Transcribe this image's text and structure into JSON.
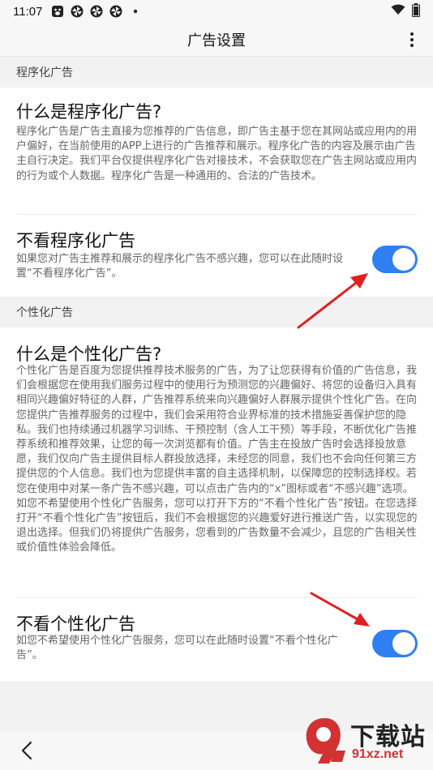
{
  "status_bar": {
    "time": "11:07",
    "icons": [
      "paw-icon",
      "pinwheel-icon",
      "pinwheel-icon",
      "pinwheel-icon",
      "dot-icon",
      "wifi-icon",
      "battery-icon"
    ]
  },
  "app_bar": {
    "title": "广告设置",
    "more_icon": "more-vertical-icon"
  },
  "programmatic": {
    "section_label": "程序化广告",
    "what_title": "什么是程序化广告?",
    "what_body": "程序化广告是广告主直接为您推荐的广告信息，即广告主基于您在其网站或应用内的用户偏好，在当前使用的APP上进行的广告推荐和展示。程序化广告的内容及展示由广告主自行决定。我们平台仅提供程序化广告对接技术，不会获取您在广告主网站或应用内的行为或个人数据。程序化广告是一种通用的、合法的广告技术。",
    "toggle_title": "不看程序化广告",
    "toggle_desc": "如果您对广告主推荐和展示的程序化广告不感兴趣，您可以在此随时设置“不看程序化广告”。",
    "toggle_on": true
  },
  "personalized": {
    "section_label": "个性化广告",
    "what_title": "什么是个性化广告?",
    "what_body": "个性化广告是百度为您提供推荐技术服务的广告，为了让您获得有价值的广告信息，我们会根据您在使用我们服务过程中的使用行为预测您的兴趣偏好、将您的设备归入具有相同兴趣偏好特征的人群，广告推荐系统来向兴趣偏好人群展示提供个性化广告。在向您提供广告推荐服务的过程中，我们会采用符合业界标准的技术措施妥善保护您的隐私。我们也持续通过机器学习训练、干预控制（含人工干预）等手段，不断优化广告推荐系统和推荐效果，让您的每一次浏览都有价值。广告主在投放广告时会选择投放意愿，我们仅向广告主提供目标人群投放选择，未经您的同意，我们也不会向任何第三方提供您的个人信息。我们也为您提供丰富的自主选择机制，以保障您的控制选择权。若您在使用中对某一条广告不感兴趣，可以点击广告内的“x”图标或者“不感兴趣”选项。如您不希望使用个性化广告服务，您可以打开下方的“不看个性化广告”按钮。在您选择打开“不看个性化广告”按钮后，我们不会根据您的兴趣爱好进行推送广告，以实现您的退出选择。但我们仍将提供广告服务，您看到的广告数量不会减少，且您的广告相关性或价值性体验会降低。",
    "toggle_title": "不看个性化广告",
    "toggle_desc": "如您不希望使用个性化广告服务，您可以在此随时设置“不看个性化广告”。",
    "toggle_on": true
  },
  "colors": {
    "accent": "#2f7ff2",
    "arrow": "#e02020",
    "background": "#f2f2f2",
    "card": "#ffffff"
  },
  "nav_bar": {
    "back_icon": "chevron-left-icon"
  },
  "watermark": {
    "brand": "下载站",
    "site": "91xz.net"
  }
}
